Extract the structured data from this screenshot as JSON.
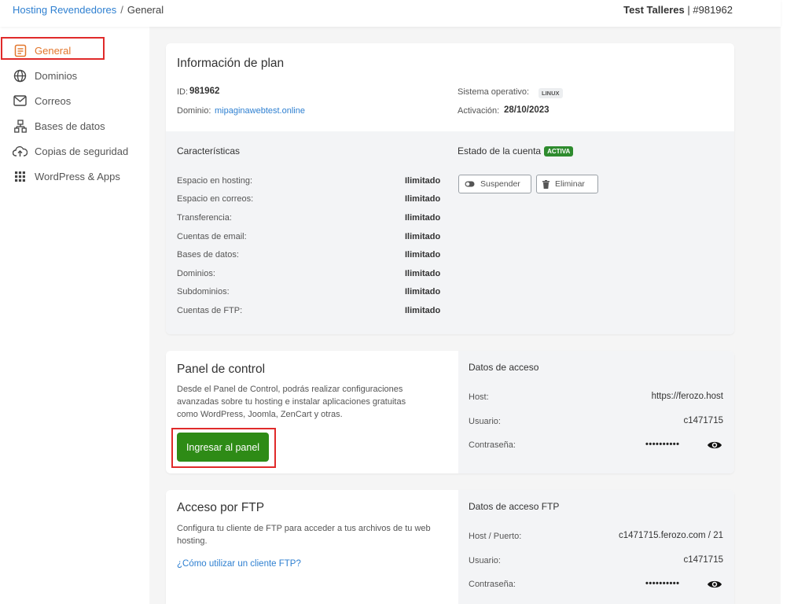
{
  "breadcrumb": {
    "parent": "Hosting Revendedores",
    "separator": "/",
    "current": "General"
  },
  "account": {
    "name": "Test Talleres",
    "separator": "|",
    "id": "#981962"
  },
  "sidebar": {
    "items": [
      {
        "label": "General",
        "icon": "document-list-icon",
        "active": true
      },
      {
        "label": "Dominios",
        "icon": "globe-icon"
      },
      {
        "label": "Correos",
        "icon": "envelope-icon"
      },
      {
        "label": "Bases de datos",
        "icon": "database-network-icon"
      },
      {
        "label": "Copias de seguridad",
        "icon": "cloud-upload-icon"
      },
      {
        "label": "WordPress & Apps",
        "icon": "grid-icon"
      }
    ]
  },
  "plan": {
    "title": "Información de plan",
    "id_label": "ID:",
    "id_value": "981962",
    "domain_label": "Dominio:",
    "domain_value": "mipaginawebtest.online",
    "os_label": "Sistema operativo:",
    "os_value": "LINUX",
    "activation_label": "Activación:",
    "activation_value": "28/10/2023",
    "features_title": "Características",
    "features": [
      {
        "label": "Espacio en hosting:",
        "value": "Ilimitado"
      },
      {
        "label": "Espacio en correos:",
        "value": "Ilimitado"
      },
      {
        "label": "Transferencia:",
        "value": "Ilimitado"
      },
      {
        "label": "Cuentas de email:",
        "value": "Ilimitado"
      },
      {
        "label": "Bases de datos:",
        "value": "Ilimitado"
      },
      {
        "label": "Dominios:",
        "value": "Ilimitado"
      },
      {
        "label": "Subdominios:",
        "value": "Ilimitado"
      },
      {
        "label": "Cuentas de FTP:",
        "value": "Ilimitado"
      }
    ],
    "status_label": "Estado de la cuenta",
    "status_value": "ACTIVA",
    "suspend_label": "Suspender",
    "delete_label": "Eliminar"
  },
  "control_panel": {
    "title": "Panel de control",
    "description": "Desde el Panel de Control, podrás realizar configuraciones avanzadas sobre tu hosting e instalar aplicaciones gratuitas como WordPress, Joomla, ZenCart y otras.",
    "button_label": "Ingresar al panel",
    "access_title": "Datos de acceso",
    "host_label": "Host:",
    "host_value": "https://ferozo.host",
    "user_label": "Usuario:",
    "user_value": "c1471715",
    "password_label": "Contraseña:",
    "password_value": "••••••••••"
  },
  "ftp": {
    "title": "Acceso por FTP",
    "description": "Configura tu cliente de FTP para acceder a tus archivos de tu web hosting.",
    "help_link": "¿Cómo utilizar un cliente FTP?",
    "access_title": "Datos de acceso FTP",
    "host_label": "Host / Puerto:",
    "host_value": "c1471715.ferozo.com / 21",
    "user_label": "Usuario:",
    "user_value": "c1471715",
    "password_label": "Contraseña:",
    "password_value": "••••••••••"
  },
  "colors": {
    "accent_orange": "#e2762b",
    "link_blue": "#2f80d1",
    "green": "#2e8b16",
    "highlight_red": "#e02a2a"
  }
}
